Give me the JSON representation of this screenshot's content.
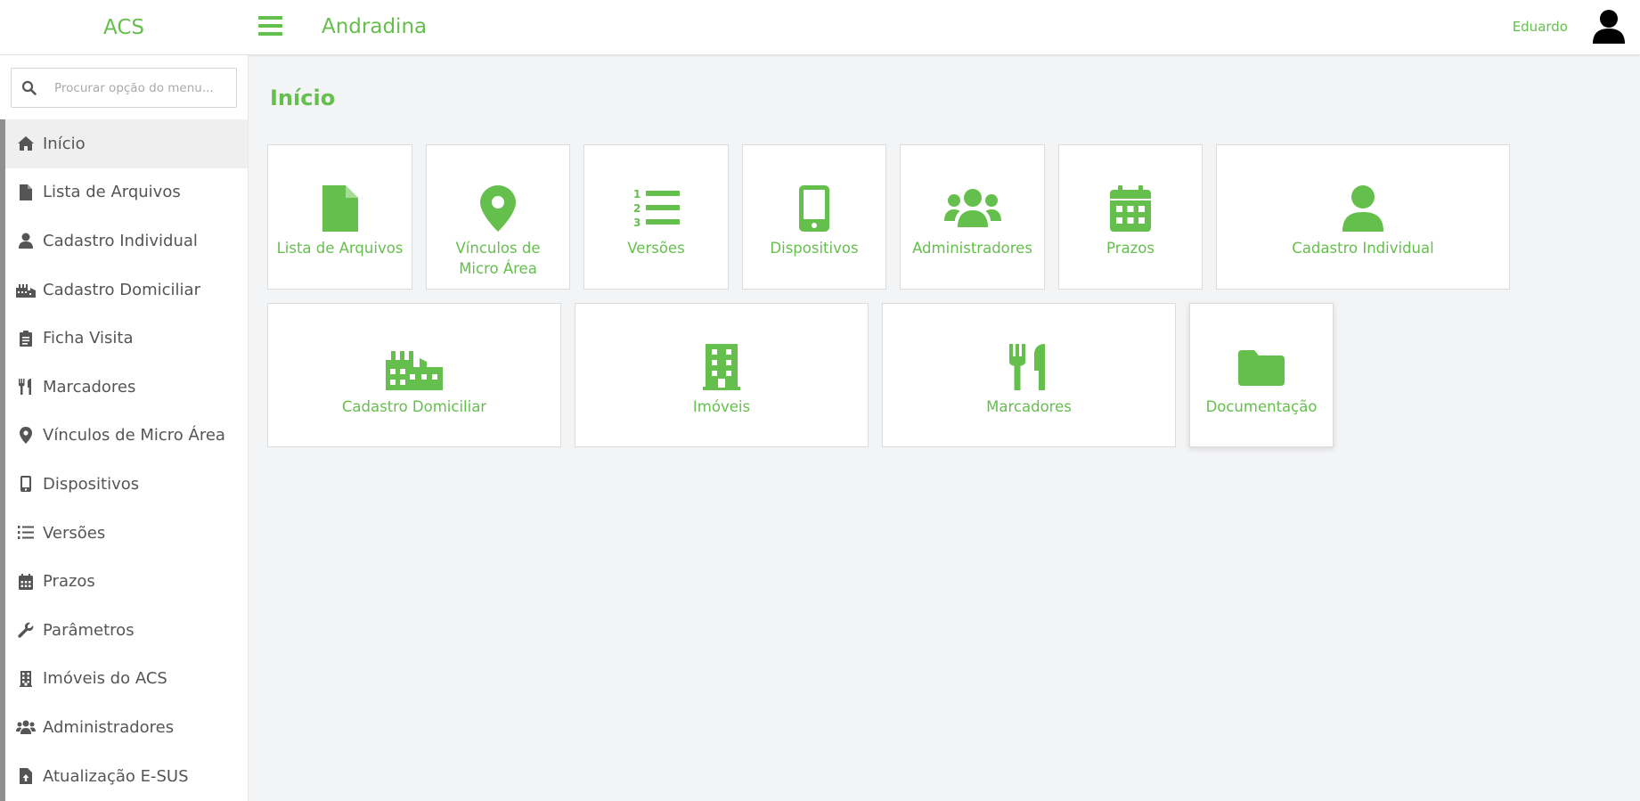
{
  "app": {
    "brand": "ACS",
    "city": "Andradina",
    "username": "Eduardo",
    "accent_color": "#65bf4d"
  },
  "search": {
    "placeholder": "Procurar opção do menu..."
  },
  "sidebar": {
    "items": [
      {
        "label": "Início",
        "icon": "home-icon"
      },
      {
        "label": "Lista de Arquivos",
        "icon": "file-icon"
      },
      {
        "label": "Cadastro Individual",
        "icon": "user-icon"
      },
      {
        "label": "Cadastro Domiciliar",
        "icon": "industry-icon"
      },
      {
        "label": "Ficha Visita",
        "icon": "clipboard-icon"
      },
      {
        "label": "Marcadores",
        "icon": "utensils-icon"
      },
      {
        "label": "Vínculos de Micro Área",
        "icon": "map-marker-icon"
      },
      {
        "label": "Dispositivos",
        "icon": "mobile-icon"
      },
      {
        "label": "Versões",
        "icon": "list-ol-icon"
      },
      {
        "label": "Prazos",
        "icon": "calendar-icon"
      },
      {
        "label": "Parâmetros",
        "icon": "wrench-icon"
      },
      {
        "label": "Imóveis do ACS",
        "icon": "building-icon"
      },
      {
        "label": "Administradores",
        "icon": "users-icon"
      },
      {
        "label": "Atualização E-SUS",
        "icon": "file-upload-icon"
      }
    ]
  },
  "main": {
    "title": "Início",
    "tiles": [
      {
        "label": "Lista de Arquivos",
        "icon": "file-icon"
      },
      {
        "label": "Vínculos de Micro Área",
        "icon": "map-marker-icon"
      },
      {
        "label": "Versões",
        "icon": "list-ol-icon"
      },
      {
        "label": "Dispositivos",
        "icon": "mobile-icon"
      },
      {
        "label": "Administradores",
        "icon": "users-icon"
      },
      {
        "label": "Prazos",
        "icon": "calendar-icon"
      },
      {
        "label": "Cadastro Individual",
        "icon": "user-icon"
      },
      {
        "label": "Cadastro Domiciliar",
        "icon": "industry-icon"
      },
      {
        "label": "Imóveis",
        "icon": "building-icon"
      },
      {
        "label": "Marcadores",
        "icon": "utensils-icon"
      },
      {
        "label": "Documentação",
        "icon": "folder-icon"
      }
    ]
  }
}
